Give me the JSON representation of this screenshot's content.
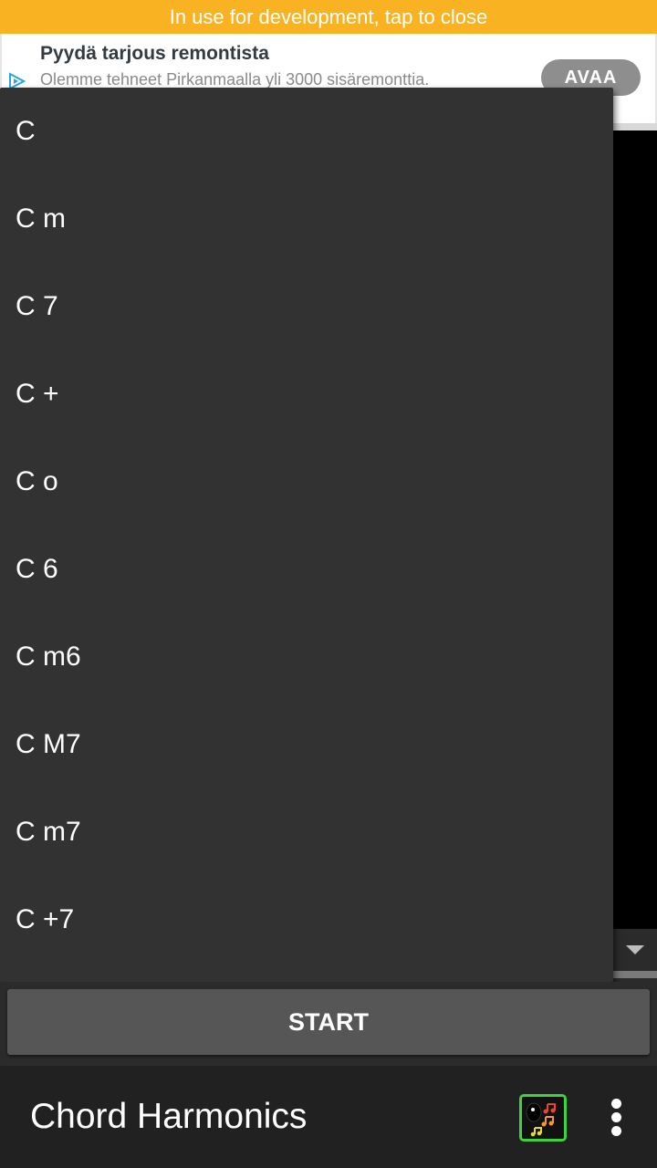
{
  "dev_banner": {
    "text": "In use for development, tap to close"
  },
  "ad": {
    "title": "Pyydä tarjous remontista",
    "subtitle": "Olemme tehneet Pirkanmaalla yli 3000 sisäremonttia.",
    "open_label": "AVAA",
    "adchoices_icon": "adchoices-icon"
  },
  "dropdown": {
    "items": [
      {
        "label": "C"
      },
      {
        "label": "C m"
      },
      {
        "label": "C 7"
      },
      {
        "label": "C +"
      },
      {
        "label": "C o"
      },
      {
        "label": "C 6"
      },
      {
        "label": "C m6"
      },
      {
        "label": "C M7"
      },
      {
        "label": "C m7"
      },
      {
        "label": "C +7"
      }
    ]
  },
  "start_button": {
    "label": "START"
  },
  "app_bar": {
    "title": "Chord Harmonics",
    "app_icon": "chord-harmonics-app-icon",
    "menu_icon": "overflow-menu-icon"
  },
  "colors": {
    "banner": "#f9b322",
    "dropdown_bg": "#323232",
    "app_bar": "#212121",
    "icon_border": "#3fd13f"
  }
}
